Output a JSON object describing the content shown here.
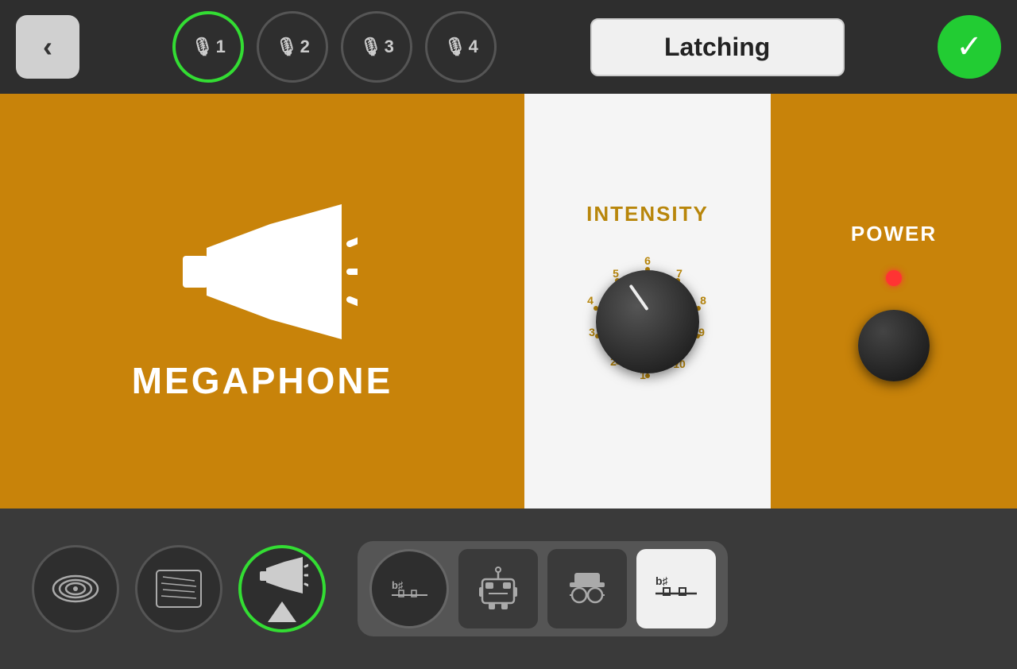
{
  "topBar": {
    "backLabel": "‹",
    "latchingLabel": "Latching",
    "confirmLabel": "✔",
    "micTabs": [
      {
        "id": 1,
        "label": "1",
        "active": true
      },
      {
        "id": 2,
        "label": "2",
        "active": false
      },
      {
        "id": 3,
        "label": "3",
        "active": false
      },
      {
        "id": 4,
        "label": "4",
        "active": false
      }
    ]
  },
  "mainArea": {
    "effectName": "MEGAPHONE",
    "intensityLabel": "INTENSITY",
    "powerLabel": "POWER",
    "knobNumbers": [
      "1",
      "2",
      "3",
      "4",
      "5",
      "6",
      "7",
      "8",
      "9",
      "10"
    ]
  },
  "bottomBar": {
    "effects": [
      {
        "id": "waves",
        "symbol": "((·))",
        "active": false
      },
      {
        "id": "static",
        "symbol": "≋≋≋",
        "active": false
      },
      {
        "id": "megaphone-btn",
        "symbol": "📢",
        "active": true
      }
    ],
    "rightEffects": [
      {
        "id": "eq",
        "symbol": "♭♯",
        "type": "circle",
        "active": false
      },
      {
        "id": "robot",
        "symbol": "🤖",
        "type": "square",
        "active": false
      },
      {
        "id": "spy",
        "symbol": "🕵",
        "type": "square",
        "active": false
      },
      {
        "id": "eq2",
        "symbol": "♭♯",
        "type": "square",
        "active": true
      }
    ]
  }
}
